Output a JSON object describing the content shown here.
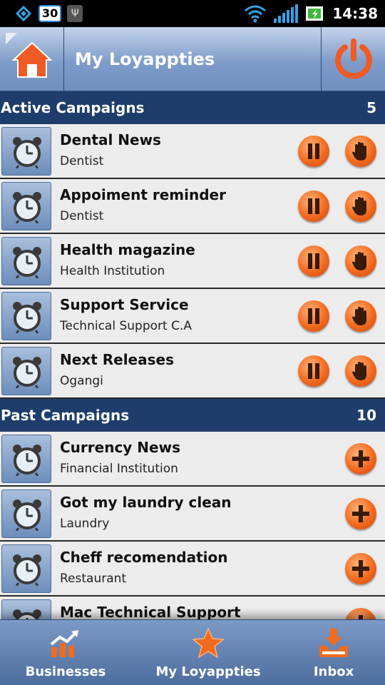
{
  "status_bar": {
    "badge": "30",
    "usb": "Ψ",
    "time": "14:38"
  },
  "header": {
    "title": "My Loyappties"
  },
  "active_campaigns": {
    "label": "Active Campaigns",
    "count": "5",
    "items": [
      {
        "title": "Dental News",
        "subtitle": "Dentist"
      },
      {
        "title": "Appoiment reminder",
        "subtitle": "Dentist"
      },
      {
        "title": "Health magazine",
        "subtitle": "Health Institution"
      },
      {
        "title": "Support Service",
        "subtitle": "Technical Support C.A"
      },
      {
        "title": "Next Releases",
        "subtitle": "Ogangi"
      }
    ]
  },
  "past_campaigns": {
    "label": "Past Campaigns",
    "count": "10",
    "items": [
      {
        "title": "Currency News",
        "subtitle": "Financial Institution"
      },
      {
        "title": "Got my laundry clean",
        "subtitle": "Laundry"
      },
      {
        "title": "Cheff recomendation",
        "subtitle": "Restaurant"
      },
      {
        "title": "Mac Technical Support",
        "subtitle": ""
      }
    ]
  },
  "bottom_nav": {
    "businesses": "Businesses",
    "loyappties": "My Loyappties",
    "inbox": "Inbox"
  },
  "icons": {
    "home": "home-icon",
    "power": "power-icon",
    "alarm": "alarm-clock-icon",
    "pause": "pause-icon",
    "stop": "stop-hand-icon",
    "add": "plus-icon",
    "businesses": "chart-up-icon",
    "loyappties": "star-icon",
    "inbox": "inbox-download-icon"
  },
  "colors": {
    "accent_orange": "#f26a1e",
    "section_header": "#1e3d6b",
    "header_blue": "#7e9cc9"
  }
}
